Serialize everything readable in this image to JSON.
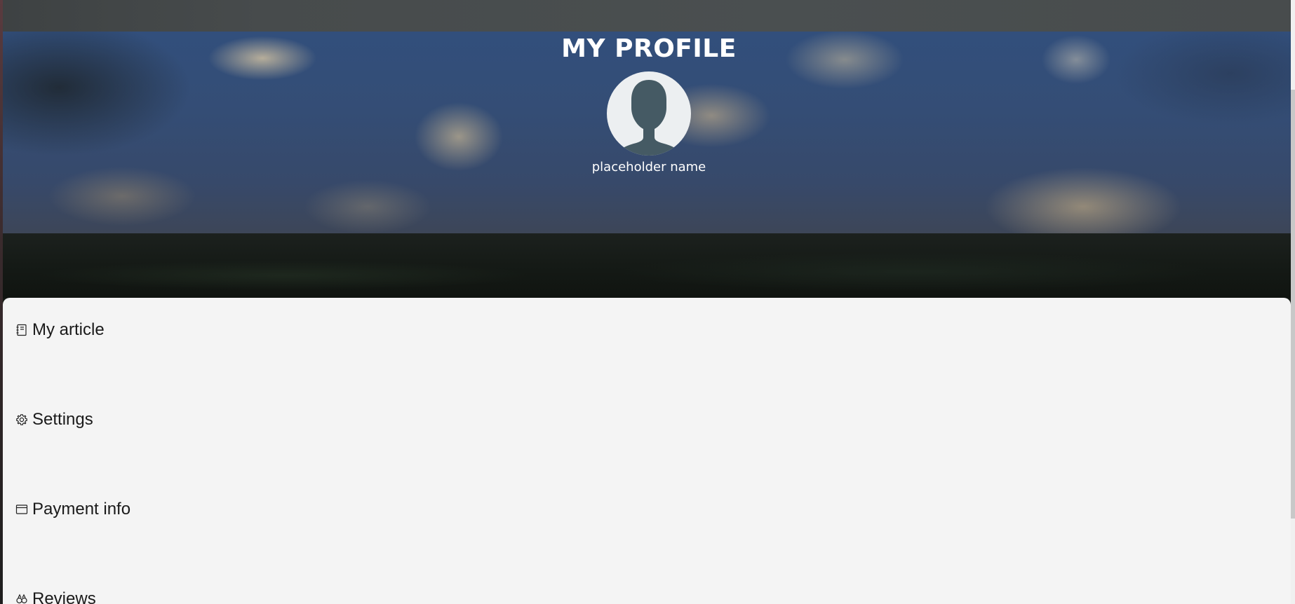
{
  "header": {
    "title": "MY PROFILE",
    "user_name": "placeholder name"
  },
  "menu": {
    "items": [
      {
        "label": "My article",
        "icon": "notebook-icon"
      },
      {
        "label": "Settings",
        "icon": "gear-icon"
      },
      {
        "label": "Payment info",
        "icon": "card-icon"
      },
      {
        "label": "Reviews",
        "icon": "reviews-icon"
      }
    ]
  },
  "colors": {
    "panel_background": "#f4f4f4",
    "avatar_background": "#eceff1",
    "avatar_silhouette": "#455a64",
    "title_text": "#ffffff"
  }
}
